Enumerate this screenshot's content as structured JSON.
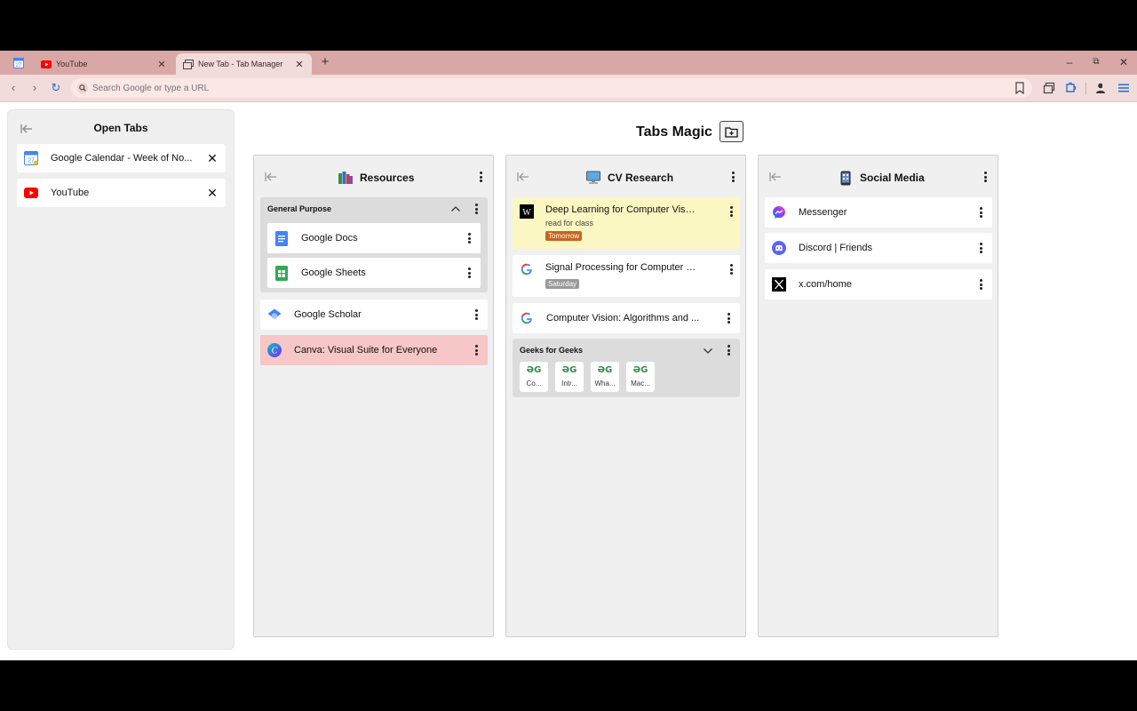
{
  "browser": {
    "tabs": [
      {
        "title": "YouTube",
        "favicon": "youtube-icon"
      },
      {
        "title": "New Tab - Tab Manager",
        "favicon": "tab-manager-icon"
      }
    ],
    "pinned_tab_favicon": "calendar-icon",
    "address_bar": {
      "placeholder": "Search Google or type a URL",
      "value": ""
    }
  },
  "sidebar": {
    "title": "Open Tabs",
    "tabs": [
      {
        "title": "Google Calendar - Week of No...",
        "favicon": "calendar-icon"
      },
      {
        "title": "YouTube",
        "favicon": "youtube-icon"
      }
    ]
  },
  "main": {
    "title": "Tabs Magic"
  },
  "columns": {
    "resources": {
      "title": "Resources",
      "emoji": "books-icon",
      "group": {
        "title": "General Purpose",
        "items": [
          {
            "title": "Google Docs",
            "favicon": "google-docs-icon"
          },
          {
            "title": "Google Sheets",
            "favicon": "google-sheets-icon"
          }
        ]
      },
      "items": [
        {
          "title": "Google Scholar",
          "favicon": "google-scholar-icon"
        },
        {
          "title": "Canva: Visual Suite for Everyone",
          "favicon": "canva-icon",
          "highlight": "#f7c6c6"
        }
      ]
    },
    "cv": {
      "title": "CV Research",
      "emoji": "computer-icon",
      "items": [
        {
          "title": "Deep Learning for Computer Visio...",
          "favicon": "wikipedia-icon",
          "note": "read for class",
          "badge": "Tomorrow",
          "badge_color": "#c8641e",
          "highlight": "#fbf7c3"
        },
        {
          "title": "Signal Processing for Computer Vi...",
          "favicon": "google-icon",
          "badge": "Saturday",
          "badge_color": "#9a9a9a"
        },
        {
          "title": "Computer Vision: Algorithms and ...",
          "favicon": "google-icon"
        }
      ],
      "group": {
        "title": "Geeks for Geeks",
        "tiles": [
          {
            "label": "Co...",
            "glyph": "ƏG"
          },
          {
            "label": "Intr...",
            "glyph": "ƏG"
          },
          {
            "label": "Wha...",
            "glyph": "ƏG"
          },
          {
            "label": "Mac...",
            "glyph": "ƏG"
          }
        ]
      }
    },
    "social": {
      "title": "Social Media",
      "emoji": "phone-icon",
      "items": [
        {
          "title": "Messenger",
          "favicon": "messenger-icon"
        },
        {
          "title": "Discord | Friends",
          "favicon": "discord-icon"
        },
        {
          "title": "x.com/home",
          "favicon": "x-icon"
        }
      ]
    }
  }
}
